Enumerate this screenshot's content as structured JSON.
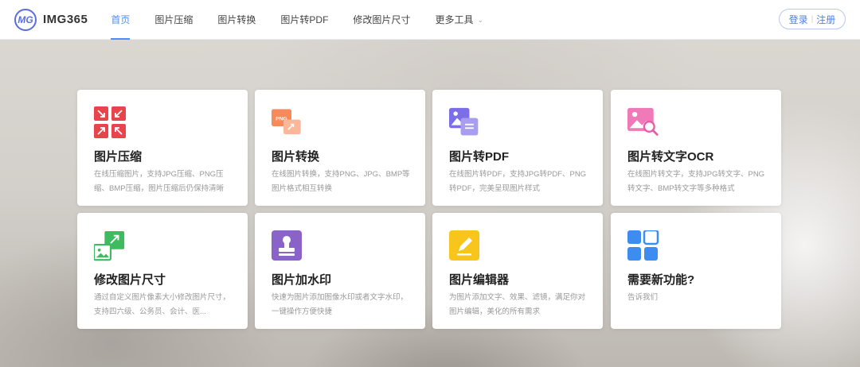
{
  "brand": {
    "name": "IMG365",
    "mark": "MG"
  },
  "nav": [
    {
      "label": "首页"
    },
    {
      "label": "图片压缩"
    },
    {
      "label": "图片转换"
    },
    {
      "label": "图片转PDF"
    },
    {
      "label": "修改图片尺寸"
    },
    {
      "label": "更多工具"
    }
  ],
  "auth": {
    "login": "登录",
    "divider": "|",
    "register": "注册"
  },
  "cards": [
    {
      "title": "图片压缩",
      "desc": "在线压缩图片，支持JPG压缩、PNG压缩、BMP压缩，图片压缩后仍保持清晰",
      "icon": "compress-icon"
    },
    {
      "title": "图片转换",
      "desc": "在线图片转换，支持PNG、JPG、BMP等图片格式相互转换",
      "icon": "convert-icon"
    },
    {
      "title": "图片转PDF",
      "desc": "在线图片转PDF，支持JPG转PDF、PNG转PDF，完美呈现图片样式",
      "icon": "image-to-pdf-icon"
    },
    {
      "title": "图片转文字OCR",
      "desc": "在线图片转文字，支持JPG转文字、PNG转文字、BMP转文字等多种格式",
      "icon": "ocr-icon"
    },
    {
      "title": "修改图片尺寸",
      "desc": "通过自定义图片像素大小修改图片尺寸，支持四六级、公务员、会计、医...",
      "icon": "resize-icon"
    },
    {
      "title": "图片加水印",
      "desc": "快速为图片添加图像水印或者文字水印，一键操作方便快捷",
      "icon": "watermark-icon"
    },
    {
      "title": "图片编辑器",
      "desc": "为图片添加文字、效果、滤镜，满足你对图片编辑，美化的所有需求",
      "icon": "editor-icon"
    },
    {
      "title": "需要新功能?",
      "desc": "告诉我们",
      "icon": "new-feature-icon"
    }
  ],
  "colors": {
    "accent": "#4c8df6",
    "compress": "#e8444c",
    "convert": "#f78a5a",
    "pdf": "#7b6ee6",
    "ocr": "#f07ab8",
    "resize": "#3dbb5e",
    "watermark": "#8a63c9",
    "editor": "#f7c51c",
    "newfeature": "#3d8cf0"
  }
}
